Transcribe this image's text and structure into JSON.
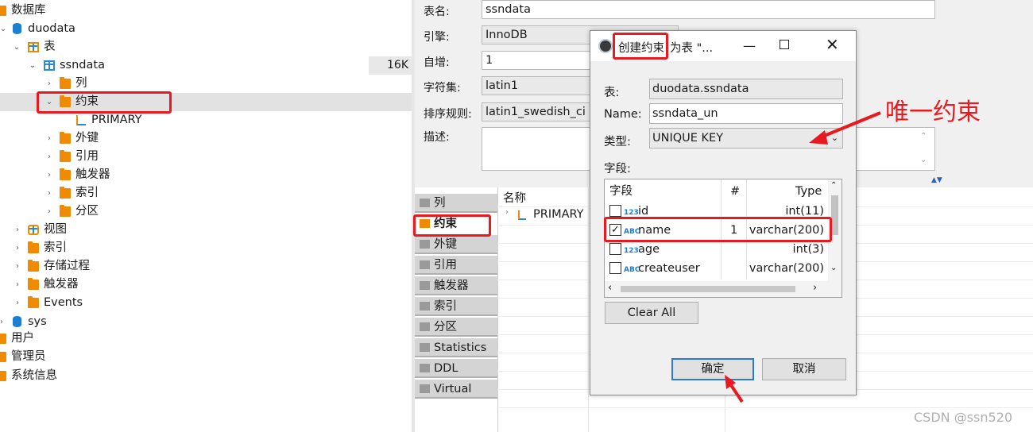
{
  "tree": {
    "items": [
      {
        "label": "数据库"
      },
      {
        "label": "duodata"
      },
      {
        "label": "表"
      },
      {
        "label": "ssndata",
        "size": "16K"
      },
      {
        "label": "列"
      },
      {
        "label": "约束"
      },
      {
        "label": "PRIMARY"
      },
      {
        "label": "外键"
      },
      {
        "label": "引用"
      },
      {
        "label": "触发器"
      },
      {
        "label": "索引"
      },
      {
        "label": "分区"
      },
      {
        "label": "视图"
      },
      {
        "label": "索引"
      },
      {
        "label": "存储过程"
      },
      {
        "label": "触发器"
      },
      {
        "label": "Events"
      },
      {
        "label": "sys"
      },
      {
        "label": "用户"
      },
      {
        "label": "管理员"
      },
      {
        "label": "系统信息"
      }
    ]
  },
  "props": {
    "table_name_label": "表名:",
    "table_name": "ssndata",
    "engine_label": "引擎:",
    "engine": "InnoDB",
    "autoinc_label": "自增:",
    "autoinc": "1",
    "charset_label": "字符集:",
    "charset": "latin1",
    "collation_label": "排序规则:",
    "collation": "latin1_swedish_ci",
    "desc_label": "描述:"
  },
  "lower": {
    "tabs": [
      "列",
      "约束",
      "外键",
      "引用",
      "触发器",
      "索引",
      "分区",
      "Statistics",
      "DDL",
      "Virtual"
    ],
    "col_header": "名称",
    "row1": "PRIMARY"
  },
  "dialog": {
    "title": "创建约束",
    "title_suffix": "为表 \"...",
    "table_label": "表:",
    "table_value": "duodata.ssndata",
    "name_label": "Name:",
    "name_value": "ssndata_un",
    "type_label": "类型:",
    "type_value": "UNIQUE KEY",
    "fields_label": "字段:",
    "headers": {
      "field": "字段",
      "num": "#",
      "type": "Type"
    },
    "rows": [
      {
        "icon": "123",
        "name": "id",
        "num": "",
        "type": "int(11)",
        "checked": false
      },
      {
        "icon": "ABC",
        "name": "name",
        "num": "1",
        "type": "varchar(200)",
        "checked": true
      },
      {
        "icon": "123",
        "name": "age",
        "num": "",
        "type": "int(3)",
        "checked": false
      },
      {
        "icon": "ABC",
        "name": "createuser",
        "num": "",
        "type": "varchar(200)",
        "checked": false
      }
    ],
    "clear_all": "Clear All",
    "ok": "确定",
    "cancel": "取消"
  },
  "annotation": {
    "text": "唯一约束",
    "color": "#e8191f"
  },
  "watermark": "CSDN @ssn520"
}
